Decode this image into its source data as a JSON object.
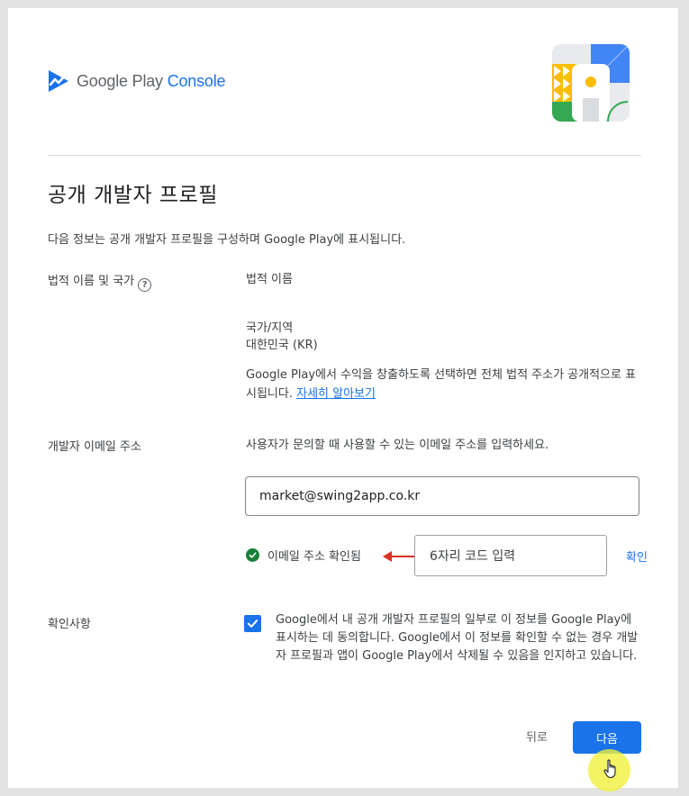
{
  "header": {
    "logo_text_google_play": "Google Play",
    "logo_text_console": "Console"
  },
  "page": {
    "title": "공개 개발자 프로필",
    "description": "다음 정보는 공개 개발자 프로필을 구성하며 Google Play에 표시됩니다."
  },
  "legal_section": {
    "label": "법적 이름 및 국가",
    "help_icon": "question-circle-icon",
    "legal_name_label": "법적 이름",
    "country_label": "국가/지역",
    "country_value": "대한민국 (KR)",
    "notice": "Google Play에서 수익을 창출하도록 선택하면 전체 법적 주소가 공개적으로 표시됩니다.",
    "learn_more": "자세히 알아보기"
  },
  "email_section": {
    "label": "개발자 이메일 주소",
    "instruction": "사용자가 문의할 때 사용할 수 있는 이메일 주소를 입력하세요.",
    "email_value": "market@swing2app.co.kr",
    "verified_text": "이메일 주소 확인됨",
    "code_placeholder": "6자리 코드 입력",
    "confirm_label": "확인"
  },
  "consent_section": {
    "label": "확인사항",
    "checked": true,
    "text": "Google에서 내 공개 개발자 프로필의 일부로 이 정보를 Google Play에 표시하는 데 동의합니다. Google에서 이 정보를 확인할 수 없는 경우 개발자 프로필과 앱이 Google Play에서 삭제될 수 있음을 인지하고 있습니다."
  },
  "footer": {
    "back_label": "뒤로",
    "next_label": "다음"
  },
  "colors": {
    "accent": "#1a73e8",
    "verified": "#188038",
    "annotation_arrow": "#d93025",
    "cursor_highlight": "#f0f03c"
  }
}
